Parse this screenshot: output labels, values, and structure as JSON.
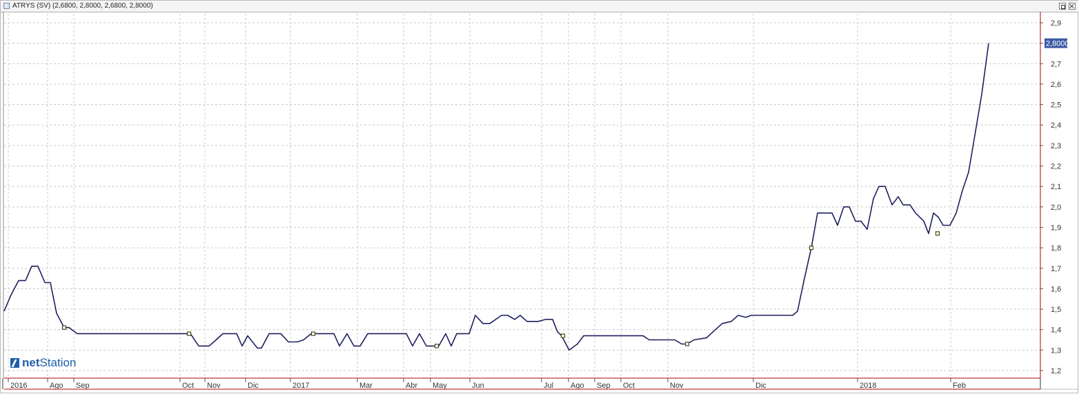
{
  "window": {
    "title": "ATRYS (SV) (2,6800, 2,8000, 2,6800, 2,8000)"
  },
  "logo": {
    "bold": "net",
    "regular": "Station"
  },
  "colors": {
    "line": "#1c1f5e",
    "grid": "#c8c8c8",
    "axis_frame": "#b00000",
    "price_tag_bg": "#3c5aa6",
    "marker": "#4a4a10"
  },
  "chart_data": {
    "type": "line",
    "title": "ATRYS (SV) (2,6800, 2,8000, 2,6800, 2,8000)",
    "xlabel": "",
    "ylabel": "",
    "ylim": [
      1.12,
      2.97
    ],
    "y_ticks": [
      "1,2",
      "1,3",
      "1,4",
      "1,5",
      "1,6",
      "1,7",
      "1,8",
      "1,9",
      "2,0",
      "2,1",
      "2,2",
      "2,3",
      "2,4",
      "2,5",
      "2,6",
      "2,7",
      "2,8",
      "2,9"
    ],
    "y_tick_values": [
      1.2,
      1.3,
      1.4,
      1.5,
      1.6,
      1.7,
      1.8,
      1.9,
      2.0,
      2.1,
      2.2,
      2.3,
      2.4,
      2.5,
      2.6,
      2.7,
      2.8,
      2.9
    ],
    "x_range": [
      0,
      1500
    ],
    "x_ticks": [
      {
        "label": "2016",
        "x": 8
      },
      {
        "label": "Ago",
        "x": 65
      },
      {
        "label": "Sep",
        "x": 103
      },
      {
        "label": "Oct",
        "x": 257
      },
      {
        "label": "Nov",
        "x": 293
      },
      {
        "label": "Dic",
        "x": 352
      },
      {
        "label": "2017",
        "x": 417
      },
      {
        "label": "Mar",
        "x": 514
      },
      {
        "label": "Abr",
        "x": 581
      },
      {
        "label": "May",
        "x": 620
      },
      {
        "label": "Jun",
        "x": 677
      },
      {
        "label": "Jul",
        "x": 781
      },
      {
        "label": "Ago",
        "x": 820
      },
      {
        "label": "Sep",
        "x": 858
      },
      {
        "label": "Oct",
        "x": 896
      },
      {
        "label": "Nov",
        "x": 964
      },
      {
        "label": "Dic",
        "x": 1088
      },
      {
        "label": "2018",
        "x": 1239
      },
      {
        "label": "Feb",
        "x": 1374
      }
    ],
    "grid": true,
    "last_value_label": "2,8000",
    "series": [
      {
        "values": [
          [
            0,
            1.49
          ],
          [
            10,
            1.57
          ],
          [
            21,
            1.64
          ],
          [
            31,
            1.64
          ],
          [
            40,
            1.71
          ],
          [
            49,
            1.71
          ],
          [
            59,
            1.63
          ],
          [
            67,
            1.63
          ],
          [
            76,
            1.48
          ],
          [
            87,
            1.41
          ],
          [
            94,
            1.41
          ],
          [
            106,
            1.38
          ],
          [
            115,
            1.38
          ],
          [
            270,
            1.38
          ],
          [
            282,
            1.32
          ],
          [
            297,
            1.32
          ],
          [
            304,
            1.34
          ],
          [
            317,
            1.38
          ],
          [
            337,
            1.38
          ],
          [
            345,
            1.32
          ],
          [
            353,
            1.37
          ],
          [
            367,
            1.31
          ],
          [
            373,
            1.31
          ],
          [
            384,
            1.38
          ],
          [
            401,
            1.38
          ],
          [
            412,
            1.34
          ],
          [
            425,
            1.34
          ],
          [
            434,
            1.35
          ],
          [
            445,
            1.38
          ],
          [
            478,
            1.38
          ],
          [
            486,
            1.32
          ],
          [
            497,
            1.38
          ],
          [
            507,
            1.32
          ],
          [
            516,
            1.32
          ],
          [
            527,
            1.38
          ],
          [
            583,
            1.38
          ],
          [
            592,
            1.32
          ],
          [
            602,
            1.38
          ],
          [
            612,
            1.32
          ],
          [
            630,
            1.32
          ],
          [
            640,
            1.38
          ],
          [
            648,
            1.32
          ],
          [
            656,
            1.38
          ],
          [
            674,
            1.38
          ],
          [
            683,
            1.47
          ],
          [
            694,
            1.43
          ],
          [
            704,
            1.43
          ],
          [
            721,
            1.47
          ],
          [
            730,
            1.47
          ],
          [
            740,
            1.45
          ],
          [
            748,
            1.47
          ],
          [
            758,
            1.44
          ],
          [
            774,
            1.44
          ],
          [
            785,
            1.45
          ],
          [
            795,
            1.45
          ],
          [
            802,
            1.39
          ],
          [
            808,
            1.37
          ],
          [
            819,
            1.3
          ],
          [
            831,
            1.33
          ],
          [
            840,
            1.37
          ],
          [
            926,
            1.37
          ],
          [
            935,
            1.35
          ],
          [
            972,
            1.35
          ],
          [
            982,
            1.33
          ],
          [
            990,
            1.33
          ],
          [
            1000,
            1.35
          ],
          [
            1018,
            1.36
          ],
          [
            1031,
            1.4
          ],
          [
            1041,
            1.43
          ],
          [
            1054,
            1.44
          ],
          [
            1064,
            1.47
          ],
          [
            1075,
            1.46
          ],
          [
            1083,
            1.47
          ],
          [
            1143,
            1.47
          ],
          [
            1150,
            1.49
          ],
          [
            1160,
            1.65
          ],
          [
            1170,
            1.8
          ],
          [
            1179,
            1.97
          ],
          [
            1200,
            1.97
          ],
          [
            1208,
            1.91
          ],
          [
            1217,
            2.0
          ],
          [
            1225,
            2.0
          ],
          [
            1234,
            1.93
          ],
          [
            1242,
            1.93
          ],
          [
            1251,
            1.89
          ],
          [
            1260,
            2.04
          ],
          [
            1268,
            2.1
          ],
          [
            1277,
            2.1
          ],
          [
            1287,
            2.01
          ],
          [
            1296,
            2.05
          ],
          [
            1303,
            2.01
          ],
          [
            1313,
            2.01
          ],
          [
            1321,
            1.97
          ],
          [
            1327,
            1.95
          ],
          [
            1333,
            1.93
          ],
          [
            1340,
            1.87
          ],
          [
            1347,
            1.97
          ],
          [
            1354,
            1.95
          ],
          [
            1361,
            1.91
          ],
          [
            1371,
            1.91
          ],
          [
            1380,
            1.97
          ],
          [
            1389,
            2.08
          ],
          [
            1398,
            2.17
          ],
          [
            1407,
            2.35
          ],
          [
            1417,
            2.55
          ],
          [
            1427,
            2.8
          ]
        ]
      }
    ],
    "markers": [
      [
        87,
        1.41
      ],
      [
        268,
        1.38
      ],
      [
        448,
        1.38
      ],
      [
        627,
        1.32
      ],
      [
        810,
        1.37
      ],
      [
        990,
        1.33
      ],
      [
        1170,
        1.8
      ],
      [
        1353,
        1.87
      ]
    ]
  }
}
